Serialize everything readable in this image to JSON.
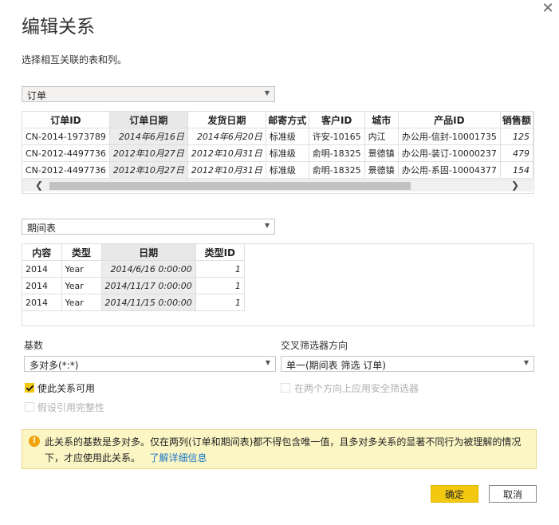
{
  "dialog": {
    "title": "编辑关系",
    "subtitle": "选择相互关联的表和列。",
    "close_icon": "close-icon"
  },
  "table1": {
    "selected": "订单",
    "headers": [
      "订单ID",
      "订单日期",
      "发货日期",
      "邮寄方式",
      "客户ID",
      "城市",
      "产品ID",
      "销售额"
    ],
    "rows": [
      [
        "CN-2014-1973789",
        "2014年6月16日",
        "2014年6月20日",
        "标准级",
        "许安-10165",
        "内江",
        "办公用-信封-10001735",
        "125"
      ],
      [
        "CN-2012-4497736",
        "2012年10月27日",
        "2012年10月31日",
        "标准级",
        "俞明-18325",
        "景德镇",
        "办公用-装订-10000237",
        "479"
      ],
      [
        "CN-2012-4497736",
        "2012年10月27日",
        "2012年10月31日",
        "标准级",
        "俞明-18325",
        "景德镇",
        "办公用-系固-10004377",
        "154"
      ]
    ],
    "scroll_left": "❮",
    "scroll_right": "❯"
  },
  "table2": {
    "selected": "期间表",
    "headers": [
      "内容",
      "类型",
      "日期",
      "类型ID"
    ],
    "rows": [
      [
        "2014",
        "Year",
        "2014/6/16 0:00:00",
        "1"
      ],
      [
        "2014",
        "Year",
        "2014/11/17 0:00:00",
        "1"
      ],
      [
        "2014",
        "Year",
        "2014/11/15 0:00:00",
        "1"
      ]
    ]
  },
  "cardinality": {
    "label": "基数",
    "value": "多对多(*:*)"
  },
  "cross_filter": {
    "label": "交叉筛选器方向",
    "value": "单一(期间表 筛选 订单)"
  },
  "options": {
    "active_label": "使此关系可用",
    "active_checked": true,
    "both_directions_label": "在两个方向上应用安全筛选器",
    "referential_label": "假设引用完整性"
  },
  "warning": {
    "text": "此关系的基数是多对多。仅在两列(订单和期间表)都不得包含唯一值，且多对多关系的显著不同行为被理解的情况下，才应使用此关系。",
    "link": "了解详细信息"
  },
  "buttons": {
    "ok": "确定",
    "cancel": "取消"
  },
  "colors": {
    "accent": "#f2c811",
    "warning_bg": "#fbf6c4",
    "link": "#1a73c9"
  }
}
